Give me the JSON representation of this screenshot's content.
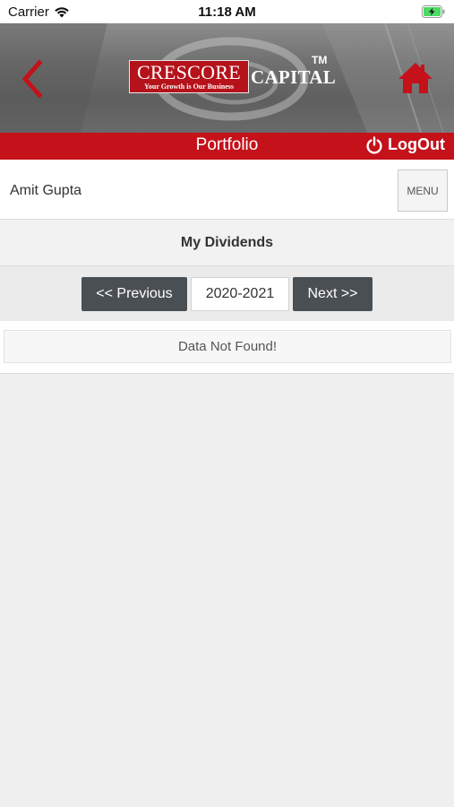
{
  "status_bar": {
    "carrier": "Carrier",
    "time": "11:18 AM"
  },
  "header": {
    "logo_word": "CRESCORE",
    "logo_tagline": "Your Growth is Our Business",
    "logo_suffix": "CAPITAL",
    "trademark": "TM",
    "back_icon": "chevron-left-icon",
    "home_icon": "home-icon"
  },
  "nav": {
    "title": "Portfolio",
    "logout_label": "LogOut",
    "logout_icon": "power-icon"
  },
  "user": {
    "name": "Amit Gupta",
    "menu_label": "MENU"
  },
  "section": {
    "title": "My Dividends"
  },
  "pager": {
    "prev_label": "<< Previous",
    "year": "2020-2021",
    "next_label": "Next >>"
  },
  "results": {
    "empty_message": "Data Not Found!"
  },
  "colors": {
    "brand_red": "#c4111a",
    "logo_red": "#b5121b",
    "button_dark": "#4a4f54"
  }
}
